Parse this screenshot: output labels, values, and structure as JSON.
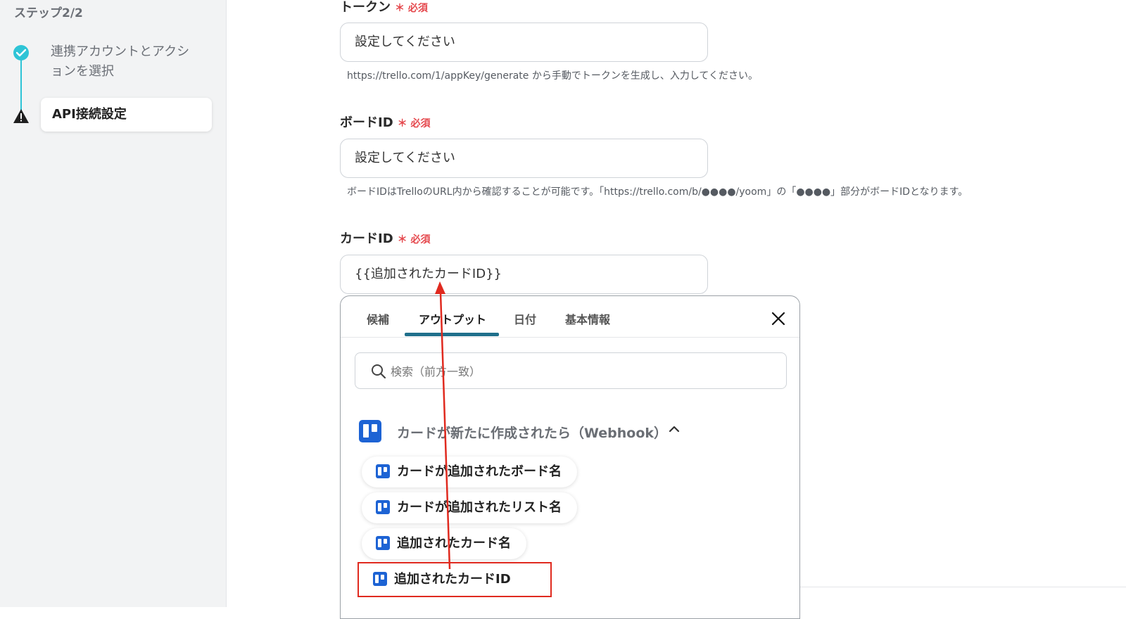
{
  "sidebar": {
    "heading": "ステップ2/2",
    "steps": [
      {
        "label": "連携アカウントとアクションを選択",
        "status": "done"
      },
      {
        "label": "API接続設定",
        "status": "current"
      }
    ]
  },
  "form": {
    "required_mark": "＊ 必須",
    "token": {
      "label": "トークン",
      "placeholder": "設定してください",
      "help": "https://trello.com/1/appKey/generate から手動でトークンを生成し、入力してください。"
    },
    "board": {
      "label": "ボードID",
      "placeholder": "設定してください",
      "help": "ボードIDはTrelloのURL内から確認することが可能です。「https://trello.com/b/●●●●/yoom」の「●●●●」部分がボードIDとなります。"
    },
    "card": {
      "label": "カードID",
      "value": "{{追加されたカードID}}"
    }
  },
  "popup": {
    "tabs": [
      "候補",
      "アウトプット",
      "日付",
      "基本情報"
    ],
    "active_tab": "アウトプット",
    "search_placeholder": "検索（前方一致）",
    "group_label": "カードが新たに作成されたら（Webhook）",
    "items": [
      "カードが追加されたボード名",
      "カードが追加されたリスト名",
      "追加されたカード名",
      "追加されたカードID"
    ],
    "selected_item": "追加されたカードID"
  },
  "colors": {
    "accent": "#2ec4d6",
    "required": "#e5484d",
    "trello": "#1d63d4",
    "highlight": "#e02a1f",
    "tab_underline": "#1f6f8b"
  }
}
